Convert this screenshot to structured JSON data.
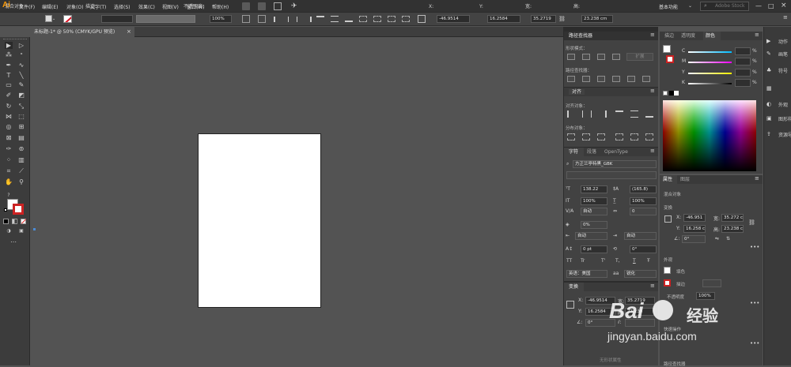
{
  "app": {
    "logo": "Ai",
    "workspace": "基本功能",
    "search_placeholder": "Adobe Stock"
  },
  "menu": [
    "文件(F)",
    "编辑(E)",
    "对象(O)",
    "文字(T)",
    "选择(S)",
    "效果(C)",
    "视图(V)",
    "窗口(W)",
    "帮助(H)"
  ],
  "control": {
    "no_selection": "混合对象",
    "stroke_label": "描边：",
    "opacity_label": "不透明度：",
    "opacity_value": "100%",
    "x_label": "X:",
    "x_value": "-46.9514",
    "y_label": "Y:",
    "y_value": "16.2584",
    "w_label": "宽:",
    "w_value": "35.2719",
    "h_label": "高:",
    "h_value": "23.238 cm"
  },
  "document": {
    "tab_title": "未标题-1* @ 50% (CMYK/GPU 预览)",
    "close": "×"
  },
  "pathfinder": {
    "title": "路径查找器",
    "shape_modes": "形状模式：",
    "expand": "扩展",
    "pathfinders": "路径查找器："
  },
  "align": {
    "title": "对齐",
    "align_objects": "对齐对象：",
    "distribute_objects": "分布对象："
  },
  "character": {
    "tabs": [
      "字符",
      "段落",
      "OpenType"
    ],
    "font": "方正兰亭特黑_GBK",
    "size": "138.22",
    "leading": "(165.8)",
    "vscale": "100%",
    "hscale": "100%",
    "kerning": "自动",
    "tracking": "0",
    "tsume": "0%",
    "aki_left": "自动",
    "aki_right": "自动",
    "baseline": "0 pt",
    "rotation": "0°",
    "styles": [
      "TT",
      "Tr",
      "T'",
      "T,",
      "T",
      "Ŧ"
    ],
    "language": "英语：美国",
    "aa_icon": "aa",
    "aa": "锐化"
  },
  "transform": {
    "title": "变换",
    "x": "-46.9514",
    "y": "16.2584",
    "w": "35.2719",
    "h": "23.238",
    "angle": "0°",
    "footer": "无形状属性"
  },
  "color": {
    "tabs": [
      "描边",
      "透明度",
      "颜色"
    ],
    "channels": [
      "C",
      "M",
      "Y",
      "K"
    ],
    "unit": "%"
  },
  "properties": {
    "tabs": [
      "属性",
      "图层"
    ],
    "no_selection": "混合对象",
    "transform": "变换",
    "x": "-46.951",
    "y": "16.258 c",
    "w": "35.272 c",
    "h": "23.238 c",
    "angle": "0°",
    "appearance": "外观",
    "fill": "填色",
    "stroke": "描边",
    "opacity_label": "不透明度",
    "opacity": "100%",
    "quick_actions": "快速操作",
    "pathfinder_footer": "路径查找器"
  },
  "dock": [
    "动作",
    "画笔",
    "符号",
    "外观",
    "图形样式",
    "资源导出"
  ],
  "watermark": {
    "brand": "Bai",
    "brand2": "经验",
    "url": "jingyan.baidu.com"
  }
}
